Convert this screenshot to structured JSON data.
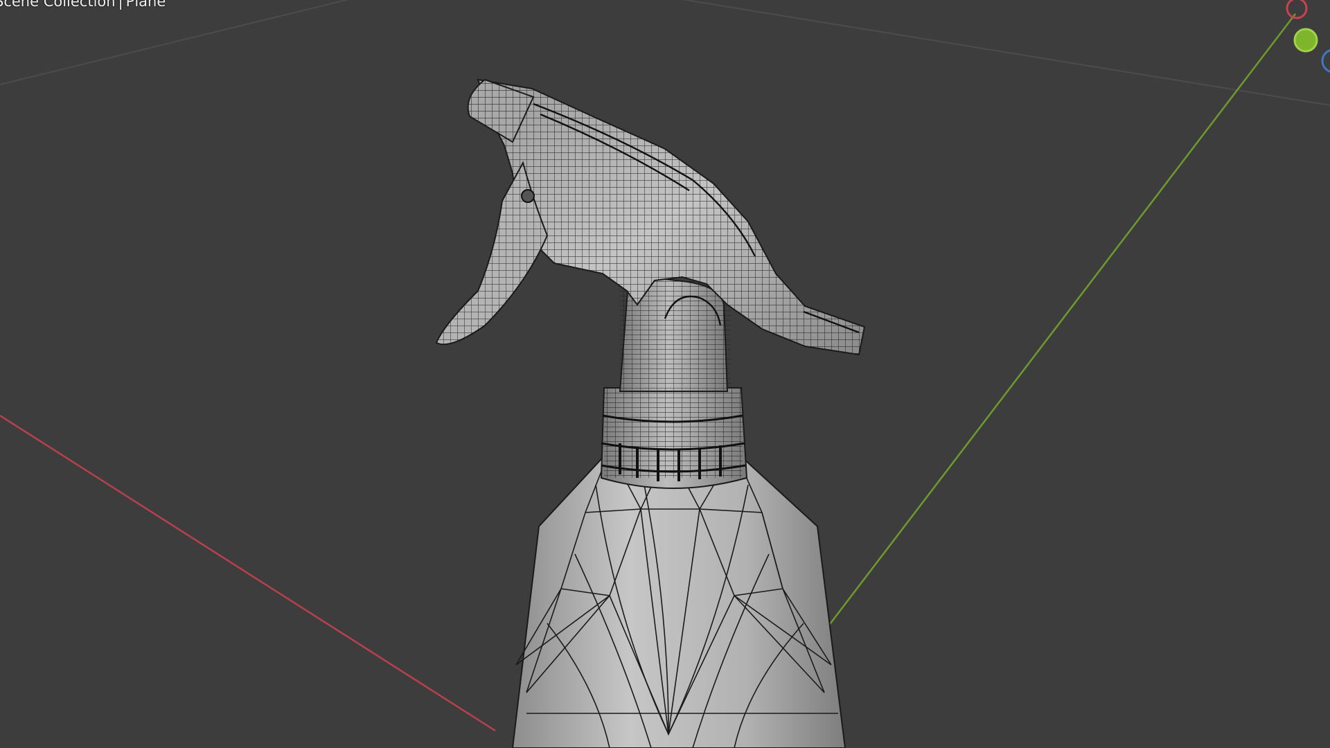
{
  "viewport": {
    "header": {
      "collection_label": "Scene Collection",
      "separator": "|",
      "object_label": "Plane"
    },
    "colors": {
      "background": "#3d3d3d",
      "grid_line": "#4a4a4a",
      "x_axis": "#b8414d",
      "y_axis": "#6f9b2c",
      "mesh_fill": "#b7b7b7",
      "mesh_wire": "#1a1a1a"
    },
    "gizmo": {
      "x_color": "#c8424f",
      "y_color": "#7fb52c",
      "z_color": "#3f78c4"
    },
    "model": {
      "description_icon": "spray-bottle-mesh"
    }
  }
}
